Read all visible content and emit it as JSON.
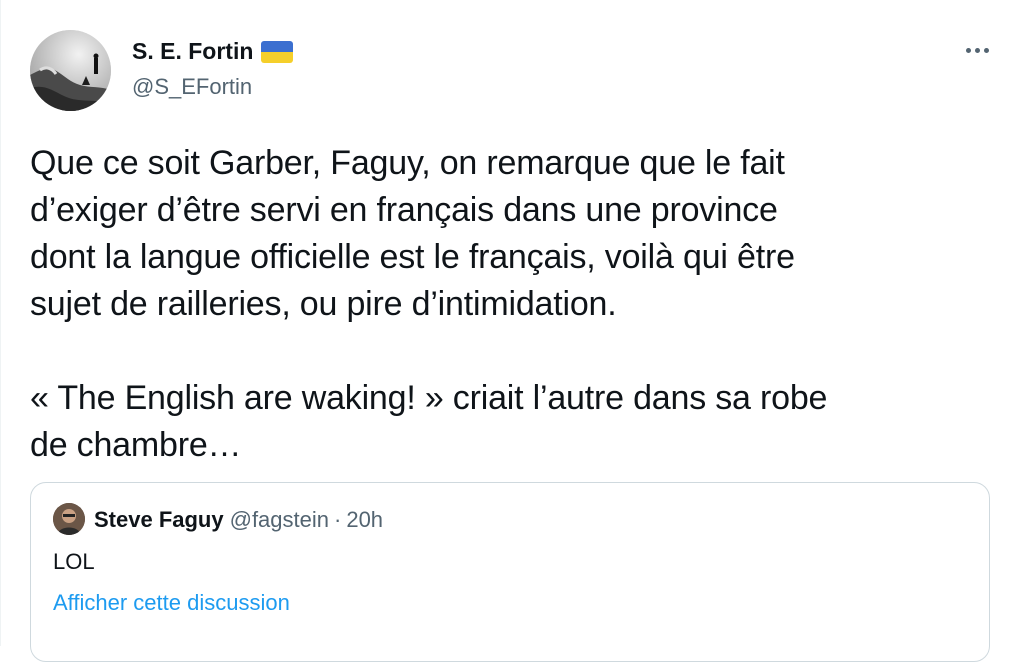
{
  "author": {
    "display_name": "S. E. Fortin",
    "handle": "@S_EFortin",
    "flag_icon": "ukraine-flag-icon"
  },
  "tweet": {
    "text": "Que ce soit Garber, Faguy, on remarque que le fait\nd’exiger d’être servi en français dans une province\ndont la langue officielle est le français, voilà qui être\nsujet de railleries, ou pire d’intimidation.\n\n« The English are waking! » criait l’autre dans sa robe\nde chambre…"
  },
  "quoted_tweet": {
    "display_name": "Steve Faguy",
    "handle": "@fagstein",
    "separator": "·",
    "time": "20h",
    "text": "LOL",
    "link_text": "Afficher cette discussion"
  },
  "colors": {
    "text_primary": "#0f1419",
    "text_secondary": "#536471",
    "link": "#1d9bf0",
    "border": "#cfd9de"
  }
}
